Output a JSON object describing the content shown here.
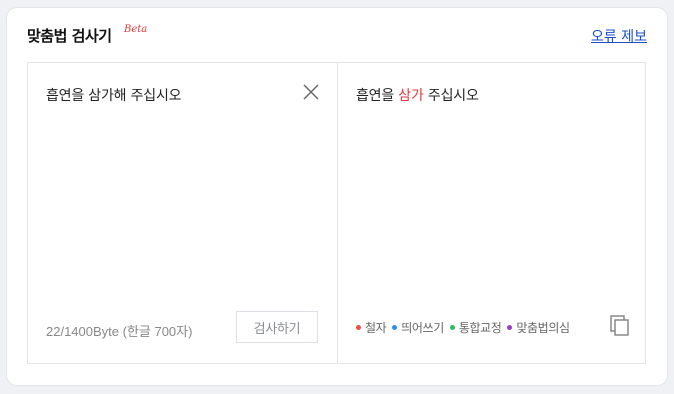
{
  "header": {
    "title": "맞춤법 검사기",
    "beta": "Beta",
    "report_link": "오류 제보"
  },
  "input_panel": {
    "text": "흡연을 삼가해 주십시오",
    "close_icon": "close-icon",
    "byte_count": "22/1400Byte (한글 700자)",
    "check_button": "검사하기"
  },
  "result_panel": {
    "before": "흡연을 ",
    "error_word": "삼가",
    "after": " 주십시오",
    "legend": [
      {
        "label": "철자",
        "color": "#ef4b4b"
      },
      {
        "label": "띄어쓰기",
        "color": "#2f8df0"
      },
      {
        "label": "통합교정",
        "color": "#2fb95e"
      },
      {
        "label": "맞춤법의심",
        "color": "#9b3fc5"
      }
    ],
    "copy_icon": "copy-icon"
  },
  "colors": {
    "accent_link": "#1a4fc7",
    "error": "#e0383d"
  }
}
